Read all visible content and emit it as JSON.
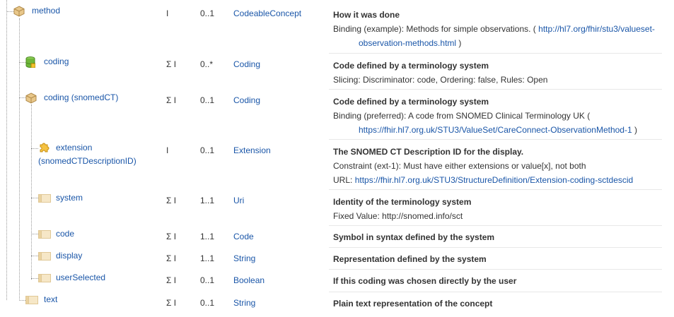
{
  "colors": {
    "link": "#1a56a8",
    "text": "#333333",
    "separator": "#e8e8e8"
  },
  "rows": [
    {
      "name": "method",
      "icon": "element-cube-icon",
      "flags": "I",
      "card": "0..1",
      "type": "CodeableConcept",
      "title": "How it was done",
      "line1_prefix": "Binding (example): Methods for simple observations. ( ",
      "line1_link": "http://hl7.org/fhir/stu3/valueset-",
      "line2_link": "observation-methods.html",
      "line2_suffix": " )"
    },
    {
      "name": "coding",
      "icon": "slice-database-icon",
      "flags": "Σ I",
      "card": "0..*",
      "type": "Coding",
      "title": "Code defined by a terminology system",
      "line1": "Slicing: Discriminator: code, Ordering: false, Rules: Open"
    },
    {
      "name": "coding (snomedCT)",
      "icon": "element-cube-icon",
      "flags": "Σ I",
      "card": "0..1",
      "type": "Coding",
      "title": "Code defined by a terminology system",
      "line1": "Binding (preferred): A code from SNOMED Clinical Terminology UK (",
      "line2_link": "https://fhir.hl7.org.uk/STU3/ValueSet/CareConnect-ObservationMethod-1",
      "line2_suffix": " )"
    },
    {
      "name1": "extension",
      "name2": "(snomedCTDescriptionID)",
      "icon": "extension-puzzle-icon",
      "flags": "I",
      "card": "0..1",
      "type": "Extension",
      "title": "The SNOMED CT Description ID for the display.",
      "line1": "Constraint (ext-1): Must have either extensions or value[x], not both",
      "line2_prefix": "URL: ",
      "line2_link": "https://fhir.hl7.org.uk/STU3/StructureDefinition/Extension-coding-sctdescid"
    },
    {
      "name": "system",
      "icon": "primitive-field-icon",
      "flags": "Σ I",
      "card": "1..1",
      "type": "Uri",
      "title": "Identity of the terminology system",
      "line1": "Fixed Value: http://snomed.info/sct"
    },
    {
      "name": "code",
      "icon": "primitive-field-icon",
      "flags": "Σ I",
      "card": "1..1",
      "type": "Code",
      "title": "Symbol in syntax defined by the system"
    },
    {
      "name": "display",
      "icon": "primitive-field-icon",
      "flags": "Σ I",
      "card": "1..1",
      "type": "String",
      "title": "Representation defined by the system"
    },
    {
      "name": "userSelected",
      "icon": "primitive-field-icon",
      "flags": "Σ I",
      "card": "0..1",
      "type": "Boolean",
      "title": "If this coding was chosen directly by the user"
    },
    {
      "name": "text",
      "icon": "primitive-field-icon",
      "flags": "Σ I",
      "card": "0..1",
      "type": "String",
      "title": "Plain text representation of the concept"
    }
  ]
}
